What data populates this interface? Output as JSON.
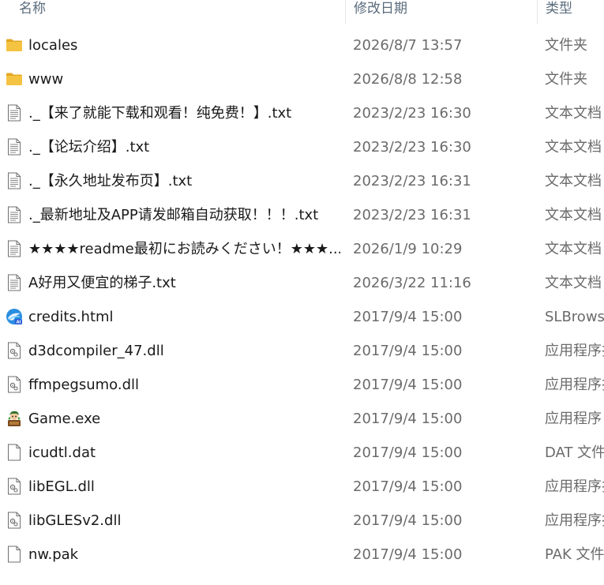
{
  "columns": {
    "name": "名称",
    "date": "修改日期",
    "type": "类型"
  },
  "colors": {
    "folder": "#f5c342",
    "folder_dark": "#e2a823",
    "header_text": "#5a6b7c",
    "secondary_text": "#6b6b6b"
  },
  "files": [
    {
      "name": "locales",
      "date": "2026/8/7 13:57",
      "type": "文件夹",
      "icon": "folder-icon"
    },
    {
      "name": "www",
      "date": "2026/8/8 12:58",
      "type": "文件夹",
      "icon": "folder-icon"
    },
    {
      "name": "._【来了就能下载和观看！纯免费！】.txt",
      "date": "2023/2/23 16:30",
      "type": "文本文档",
      "icon": "text-file-icon"
    },
    {
      "name": "._【论坛介绍】.txt",
      "date": "2023/2/23 16:30",
      "type": "文本文档",
      "icon": "text-file-icon"
    },
    {
      "name": "._【永久地址发布页】.txt",
      "date": "2023/2/23 16:31",
      "type": "文本文档",
      "icon": "text-file-icon"
    },
    {
      "name": "._最新地址及APP请发邮箱自动获取！！！.txt",
      "date": "2023/2/23 16:31",
      "type": "文本文档",
      "icon": "text-file-icon"
    },
    {
      "name": "★★★★readme最初にお読みください！★★★...",
      "date": "2026/1/9 10:29",
      "type": "文本文档",
      "icon": "text-file-icon"
    },
    {
      "name": "A好用又便宜的梯子.txt",
      "date": "2026/3/22 11:16",
      "type": "文本文档",
      "icon": "text-file-icon"
    },
    {
      "name": "credits.html",
      "date": "2017/9/4 15:00",
      "type": "SLBrowse",
      "icon": "browser-html-icon"
    },
    {
      "name": "d3dcompiler_47.dll",
      "date": "2017/9/4 15:00",
      "type": "应用程序扩",
      "icon": "dll-file-icon"
    },
    {
      "name": "ffmpegsumo.dll",
      "date": "2017/9/4 15:00",
      "type": "应用程序扩",
      "icon": "dll-file-icon"
    },
    {
      "name": "Game.exe",
      "date": "2017/9/4 15:00",
      "type": "应用程序",
      "icon": "game-exe-icon"
    },
    {
      "name": "icudtl.dat",
      "date": "2017/9/4 15:00",
      "type": "DAT 文件",
      "icon": "blank-file-icon"
    },
    {
      "name": "libEGL.dll",
      "date": "2017/9/4 15:00",
      "type": "应用程序扩",
      "icon": "dll-file-icon"
    },
    {
      "name": "libGLESv2.dll",
      "date": "2017/9/4 15:00",
      "type": "应用程序扩",
      "icon": "dll-file-icon"
    },
    {
      "name": "nw.pak",
      "date": "2017/9/4 15:00",
      "type": "PAK 文件",
      "icon": "blank-file-icon"
    }
  ]
}
